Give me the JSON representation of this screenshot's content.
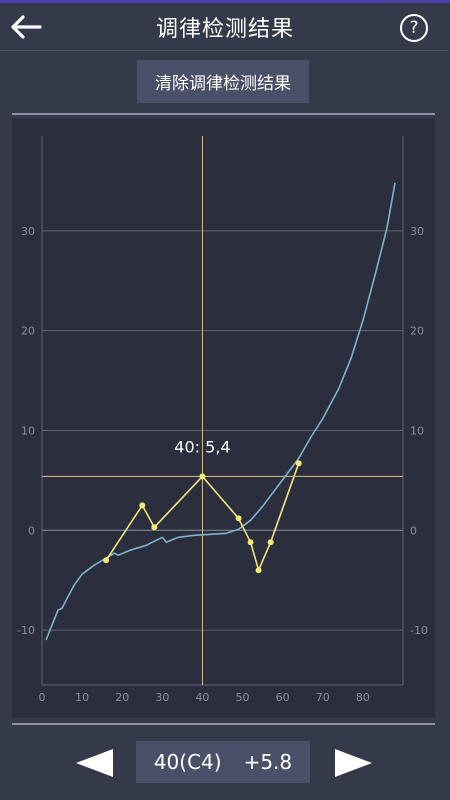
{
  "header": {
    "title": "调律检测结果",
    "back_icon": "arrow-left-icon",
    "help_label": "?"
  },
  "toolbar": {
    "clear_label": "清除调律检测结果"
  },
  "footer": {
    "note": "40(C4)",
    "deviation": "+5.8",
    "prev_icon": "triangle-left-icon",
    "next_icon": "triangle-right-icon"
  },
  "colors": {
    "background": "#353a4b",
    "chart_bg": "#2b2f3d",
    "curve": "#7fb2cc",
    "measured": "#f3e87a",
    "cursor": "#d9c08a",
    "grid": "#5e6273",
    "tick": "#8b8f9c"
  },
  "chart_data": {
    "type": "line",
    "xlim": [
      0,
      90
    ],
    "ylim": [
      -15.5,
      39.5
    ],
    "xticks": [
      0,
      10,
      20,
      30,
      40,
      50,
      60,
      70,
      80
    ],
    "yticks": [
      -10,
      0,
      10,
      20,
      30
    ],
    "grid": true,
    "cursor": {
      "x": 40,
      "y": 5.4,
      "label": "40: 5,4"
    },
    "series": [
      {
        "kind": "curve",
        "x": [
          1,
          3,
          4,
          5,
          6,
          8,
          10,
          13,
          16,
          18,
          19,
          22,
          26,
          30,
          31,
          34,
          38,
          42,
          46,
          49,
          52,
          55,
          58,
          61,
          64,
          67,
          70,
          74,
          77,
          80,
          83,
          86,
          88
        ],
        "y": [
          -11,
          -9,
          -8,
          -7.8,
          -7,
          -5.5,
          -4.4,
          -3.5,
          -2.8,
          -2.3,
          -2.5,
          -2,
          -1.5,
          -0.7,
          -1.2,
          -0.7,
          -0.5,
          -0.4,
          -0.3,
          0.1,
          1,
          2.4,
          4,
          5.6,
          7.2,
          9.3,
          11.2,
          14.2,
          17.2,
          21,
          25.5,
          30.3,
          34.8
        ]
      },
      {
        "kind": "measured",
        "x": [
          16,
          25,
          28,
          40,
          49,
          52,
          54,
          57,
          64
        ],
        "y": [
          -3,
          2.5,
          0.3,
          5.4,
          1.2,
          -1.2,
          -4,
          -1.2,
          6.7
        ]
      }
    ]
  }
}
